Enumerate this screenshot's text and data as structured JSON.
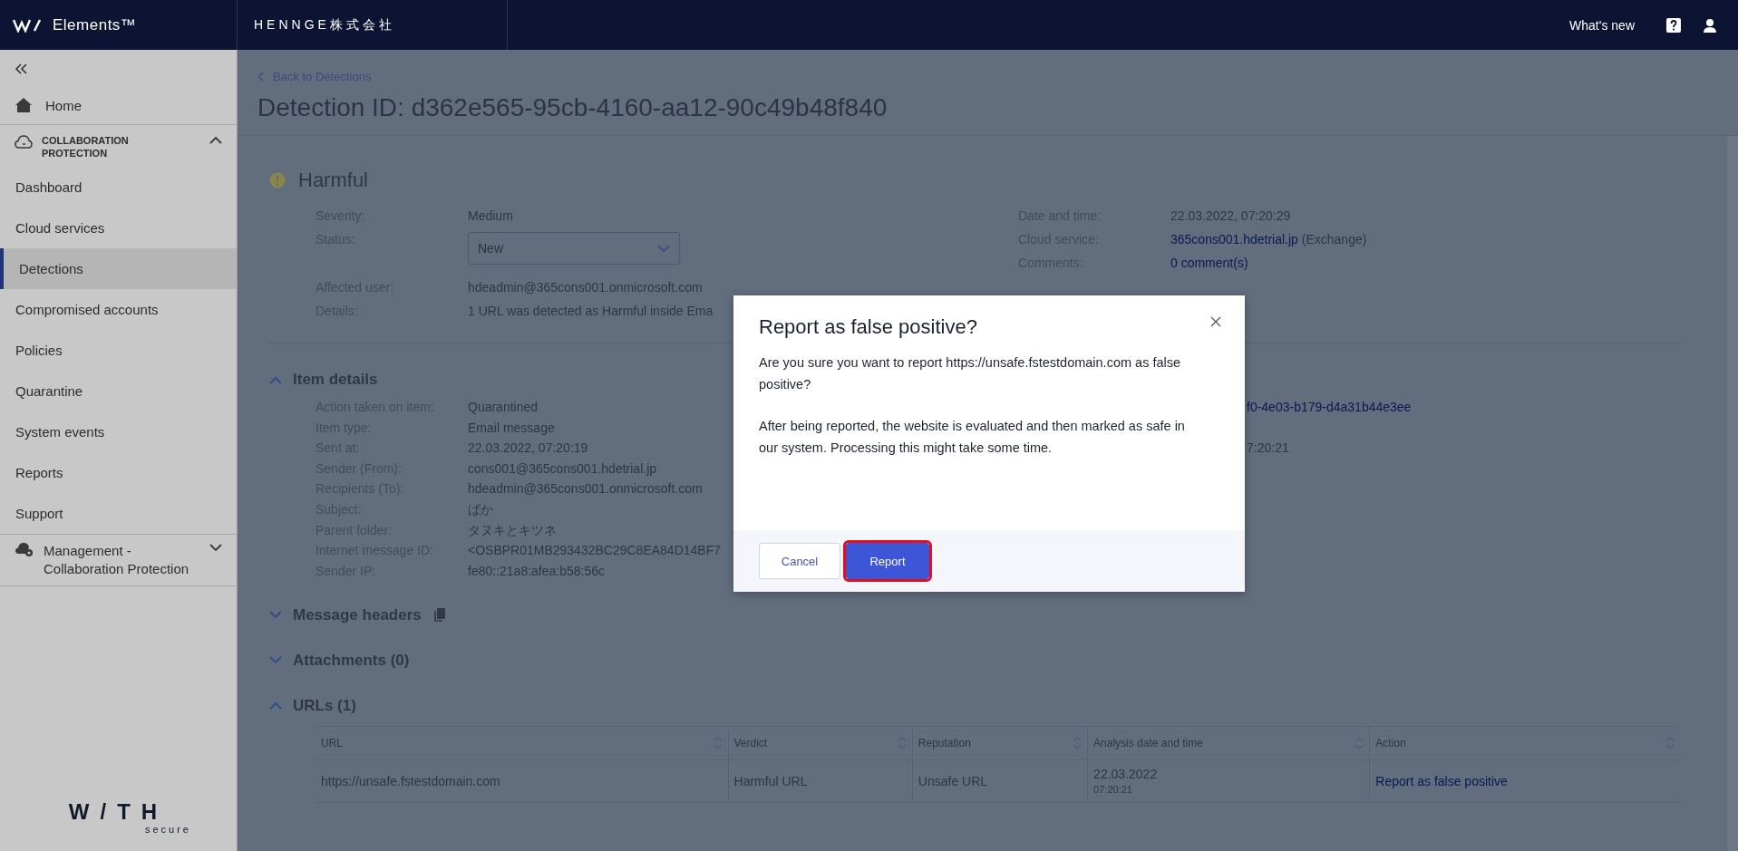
{
  "topbar": {
    "product": "Elements™",
    "organization": "HENNGE株式会社",
    "whats_new": "What's new"
  },
  "sidebar": {
    "items": [
      {
        "kind": "home",
        "label": "Home"
      },
      {
        "kind": "section",
        "label": "COLLABORATION PROTECTION",
        "expanded": true,
        "children": [
          {
            "label": "Dashboard",
            "selected": false
          },
          {
            "label": "Cloud services",
            "selected": false
          },
          {
            "label": "Detections",
            "selected": true
          },
          {
            "label": "Compromised accounts",
            "selected": false
          },
          {
            "label": "Policies",
            "selected": false
          },
          {
            "label": "Quarantine",
            "selected": false
          },
          {
            "label": "System events",
            "selected": false
          },
          {
            "label": "Reports",
            "selected": false
          },
          {
            "label": "Support",
            "selected": false
          }
        ]
      },
      {
        "kind": "group",
        "label": "Management - Collaboration Protection",
        "expanded": false
      }
    ],
    "logo": {
      "word": "W/TH",
      "sub": "secure"
    }
  },
  "page": {
    "back_link": "Back to Detections",
    "title": "Detection ID: d362e565-95cb-4160-aa12-90c49b48f840"
  },
  "summary": {
    "verdict": "Harmful",
    "left_fields": [
      {
        "label": "Severity:",
        "value": "Medium",
        "kind": "text"
      },
      {
        "label": "Status:",
        "value": "New",
        "kind": "select"
      },
      {
        "label": "Affected user:",
        "value": "hdeadmin@365cons001.onmicrosoft.com",
        "kind": "text"
      },
      {
        "label": "Details:",
        "value": "1 URL was detected as Harmful inside Ema",
        "kind": "text"
      }
    ],
    "right_fields": [
      {
        "label": "Date and time:",
        "value": "22.03.2022, 07:20:29",
        "kind": "text"
      },
      {
        "label": "Cloud service:",
        "value": "365cons001.hdetrial.jp",
        "suffix": "(Exchange)",
        "kind": "link"
      },
      {
        "label": "Comments:",
        "value": "0 comment(s)",
        "kind": "link"
      }
    ]
  },
  "sections": [
    {
      "title": "Item details",
      "expanded": true,
      "fields": [
        {
          "label": "Action taken on item:",
          "value": "Quarantined"
        },
        {
          "label": "Item type:",
          "value": "Email message"
        },
        {
          "label": "Sent at:",
          "value": "22.03.2022, 07:20:19"
        },
        {
          "label": "Sender (From):",
          "value": "cons001@365cons001.hdetrial.jp"
        },
        {
          "label": "Recipients (To):",
          "value": "hdeadmin@365cons001.onmicrosoft.com"
        },
        {
          "label": "Subject:",
          "value": "ばか"
        },
        {
          "label": "Parent folder:",
          "value": "タヌキとキツネ"
        },
        {
          "label": "Internet message ID:",
          "value": "<OSBPR01MB293432BC29C8EA84D14BF7"
        },
        {
          "label": "Sender IP:",
          "value": "fe80::21a8:afea:b58:56c"
        }
      ],
      "right_values": [
        {
          "kind": "link",
          "value": "f0-4e03-b179-d4a31b44e3ee"
        },
        {
          "kind": "blank"
        },
        {
          "kind": "text",
          "value": "7:20:21"
        }
      ]
    },
    {
      "title": "Message headers",
      "expanded": false,
      "copy": true
    },
    {
      "title": "Attachments (0)",
      "expanded": false
    },
    {
      "title": "URLs (1)",
      "expanded": true,
      "table": {
        "columns": [
          "URL",
          "Verdict",
          "Reputation",
          "Analysis date and time",
          "Action"
        ],
        "rows": [
          {
            "url": "https://unsafe.fstestdomain.com",
            "verdict": "Harmful URL",
            "reputation": "Unsafe URL",
            "date": "22.03.2022",
            "time": "07:20:21",
            "action": "Report as false positive"
          }
        ]
      }
    }
  ],
  "modal": {
    "title": "Report as false positive?",
    "paragraphs": [
      "Are you sure you want to report https://unsafe.fstestdomain.com as false positive?",
      "After being reported, the website is evaluated and then marked as safe in our system. Processing this might take some time."
    ],
    "buttons": [
      {
        "label": "Cancel",
        "kind": "secondary",
        "highlighted": false
      },
      {
        "label": "Report",
        "kind": "primary",
        "highlighted": true
      }
    ]
  }
}
